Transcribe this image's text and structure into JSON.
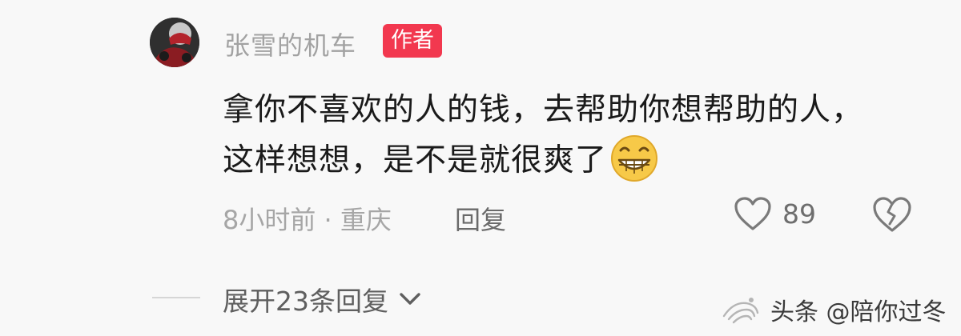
{
  "comment": {
    "username": "张雪的机车",
    "author_badge": "作者",
    "text_line1": "拿你不喜欢的人的钱，去帮助你想帮助的人，",
    "text_line2": "这样想想，是不是就很爽了",
    "emoji": "grinning-face",
    "meta": "8小时前 · 重庆",
    "reply_label": "回复",
    "like_count": "89",
    "expand_replies_label": "展开23条回复"
  },
  "watermark": {
    "text": "头条 @陪你过冬"
  },
  "colors": {
    "badge_bg": "#f2384f",
    "text_primary": "#1a1a1a",
    "text_secondary": "#a2a2a2",
    "emoji_yellow": "#f7c948"
  },
  "icons": {
    "like": "heart-outline-icon",
    "dislike": "broken-heart-icon",
    "expand": "chevron-down-icon",
    "emoji": "grinning-face-icon"
  }
}
